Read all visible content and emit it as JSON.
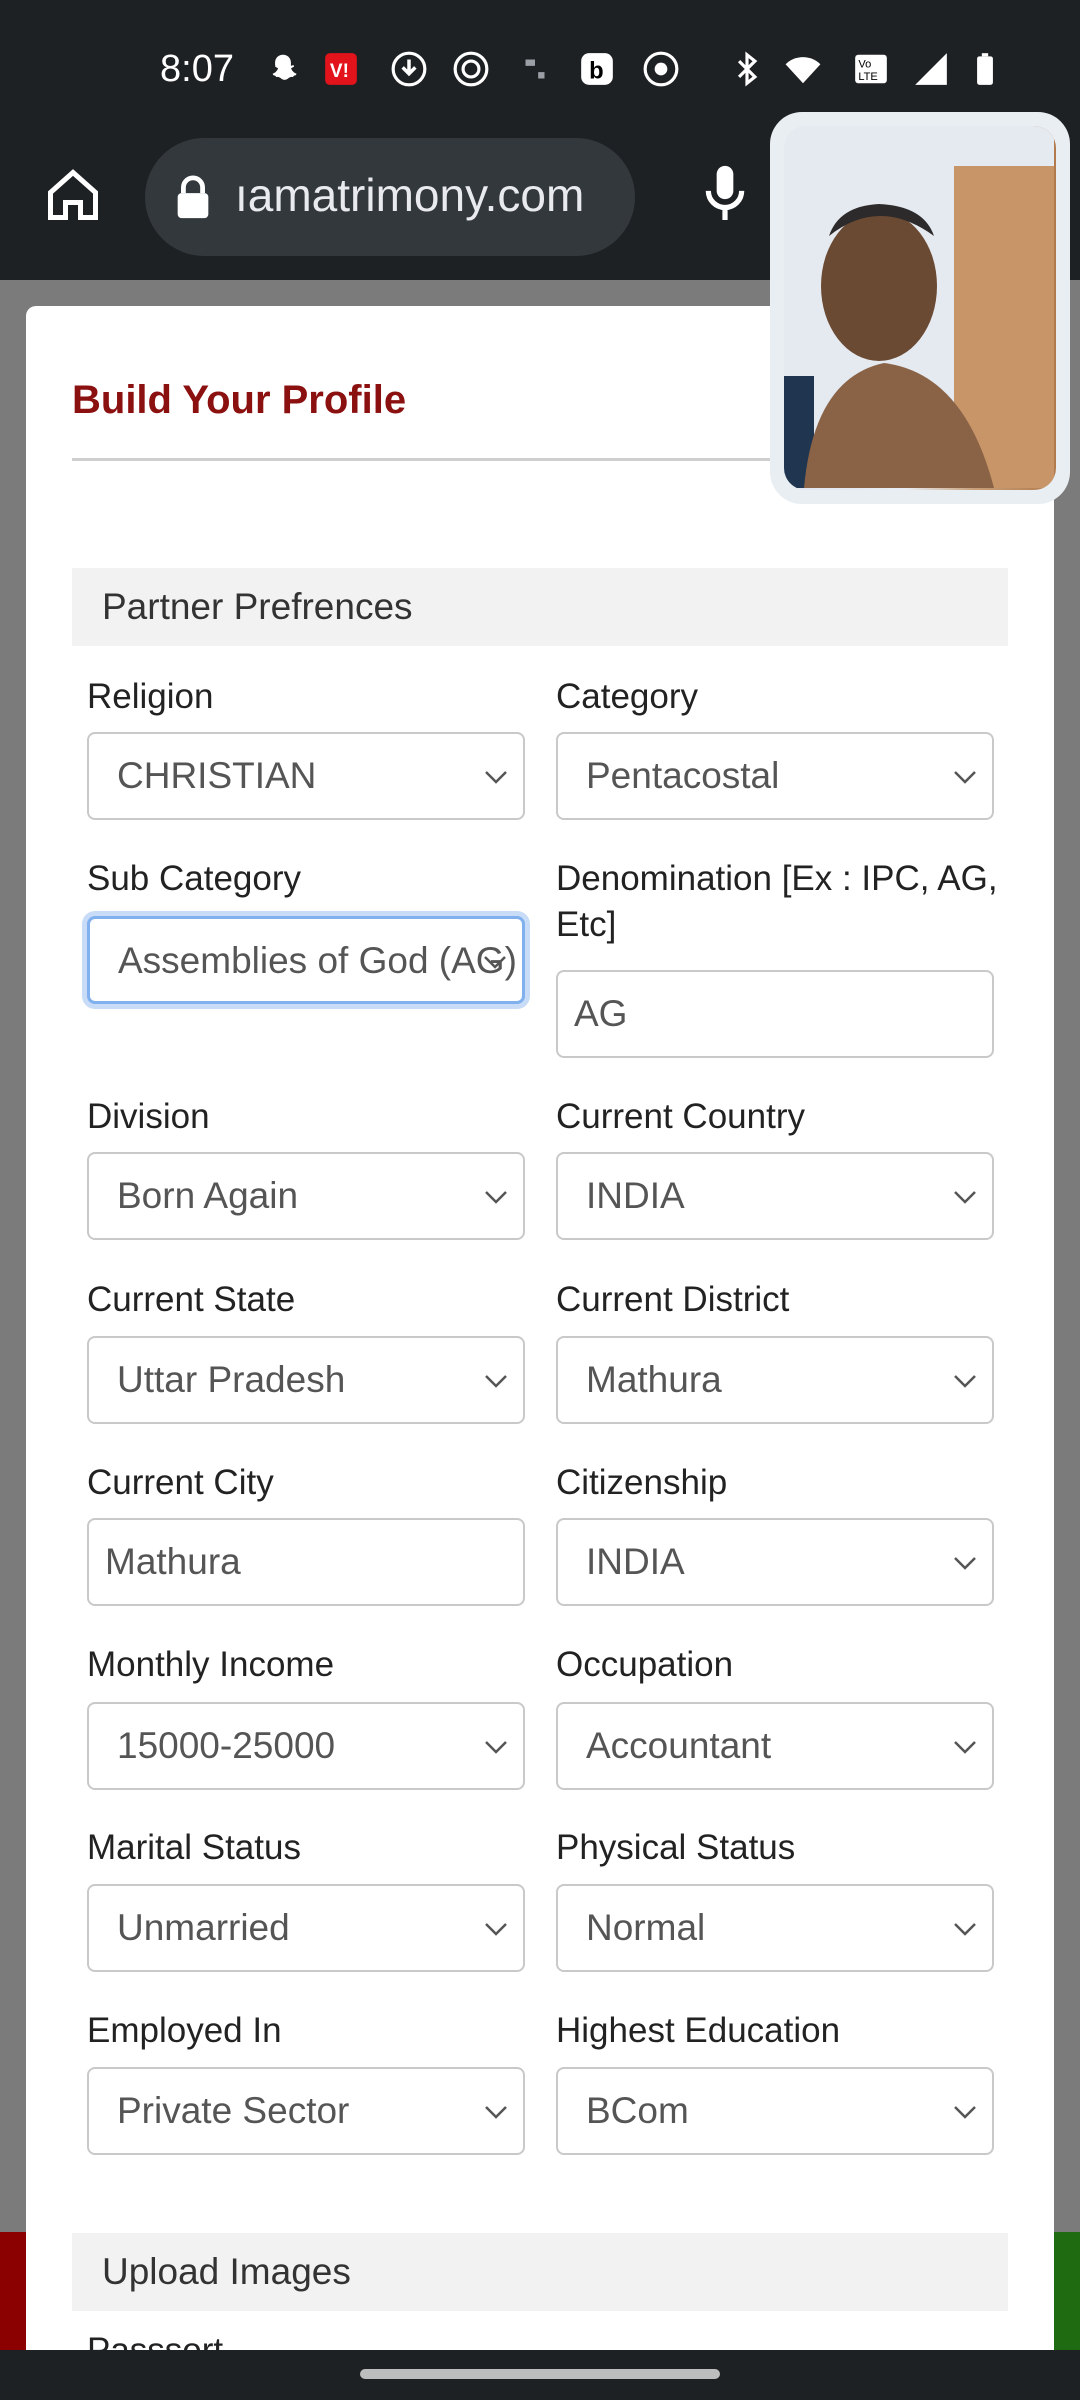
{
  "status_bar": {
    "time": "8:07",
    "icons": [
      "snapchat-icon",
      "vi-app-icon",
      "download-icon",
      "app-icon",
      "media-icon",
      "b-app-icon",
      "chrome-icon",
      "bluetooth-icon",
      "wifi-icon",
      "volte-icon",
      "signal-icon",
      "battery-icon"
    ]
  },
  "browser": {
    "url": "ıamatrimony.com",
    "home_icon": "home-icon",
    "lock_icon": "lock-icon",
    "mic_icon": "mic-icon"
  },
  "modal": {
    "title": "Build Your Profile",
    "sections": {
      "partner": "Partner Prefrences",
      "upload": "Upload Images",
      "passport_partial": "Passsort"
    },
    "fields": {
      "religion": {
        "label": "Religion",
        "value": "CHRISTIAN"
      },
      "category": {
        "label": "Category",
        "value": "Pentacostal"
      },
      "sub_category": {
        "label": "Sub Category",
        "value": "Assemblies of God (AG)"
      },
      "denomination": {
        "label": "Denomination [Ex : IPC, AG, Etc]",
        "value": "AG"
      },
      "division": {
        "label": "Division",
        "value": "Born Again"
      },
      "current_country": {
        "label": "Current Country",
        "value": "INDIA"
      },
      "current_state": {
        "label": "Current State",
        "value": "Uttar Pradesh"
      },
      "current_district": {
        "label": "Current District",
        "value": "Mathura"
      },
      "current_city": {
        "label": "Current City",
        "value": "Mathura"
      },
      "citizenship": {
        "label": "Citizenship",
        "value": "INDIA"
      },
      "monthly_income": {
        "label": "Monthly Income",
        "value": "15000-25000"
      },
      "occupation": {
        "label": "Occupation",
        "value": "Accountant"
      },
      "marital_status": {
        "label": "Marital Status",
        "value": "Unmarried"
      },
      "physical_status": {
        "label": "Physical Status",
        "value": "Normal"
      },
      "employed_in": {
        "label": "Employed In",
        "value": "Private Sector"
      },
      "highest_education": {
        "label": "Highest Education",
        "value": "BCom"
      }
    }
  },
  "colors": {
    "title": "#8b1010",
    "focus": "#80b0ee",
    "chrome_bar": "#1e2124"
  }
}
